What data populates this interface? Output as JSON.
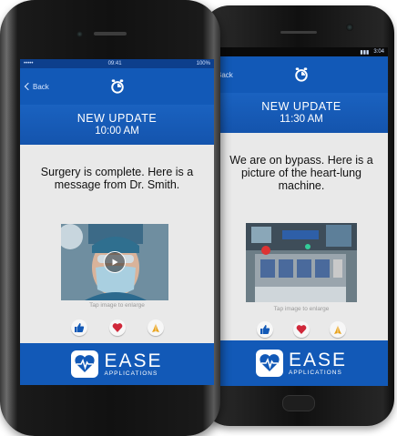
{
  "phone_left": {
    "status": {
      "carrier": "•••••",
      "time": "09:41",
      "battery": "100%"
    },
    "nav": {
      "back_label": "Back"
    },
    "update": {
      "title": "NEW UPDATE",
      "time": "10:00 AM"
    },
    "message": "Surgery is complete. Here is a message from Dr. Smith.",
    "media": {
      "type": "video",
      "hint": "Tap image to enlarge"
    },
    "reactions": [
      "thumbs-up-icon",
      "heart-icon",
      "prayer-icon"
    ],
    "brand": {
      "name": "EASE",
      "tagline": "APPLICATIONS"
    }
  },
  "phone_right": {
    "status": {
      "time": "3:04"
    },
    "nav": {
      "back_label": "Back"
    },
    "update": {
      "title": "NEW UPDATE",
      "time": "11:30 AM"
    },
    "message": "We are on bypass. Here is a picture of the heart-lung machine.",
    "media": {
      "type": "photo",
      "hint": "Tap image to enlarge"
    },
    "reactions": [
      "thumbs-up-icon",
      "heart-icon",
      "prayer-icon"
    ],
    "brand": {
      "name": "EASE",
      "tagline": "APPLICATIONS"
    }
  },
  "colors": {
    "brand_blue": "#1259b7",
    "dark_blue": "#0d3f8c",
    "heart_red": "#d0283a",
    "screen_bg": "#e9e9e9"
  }
}
